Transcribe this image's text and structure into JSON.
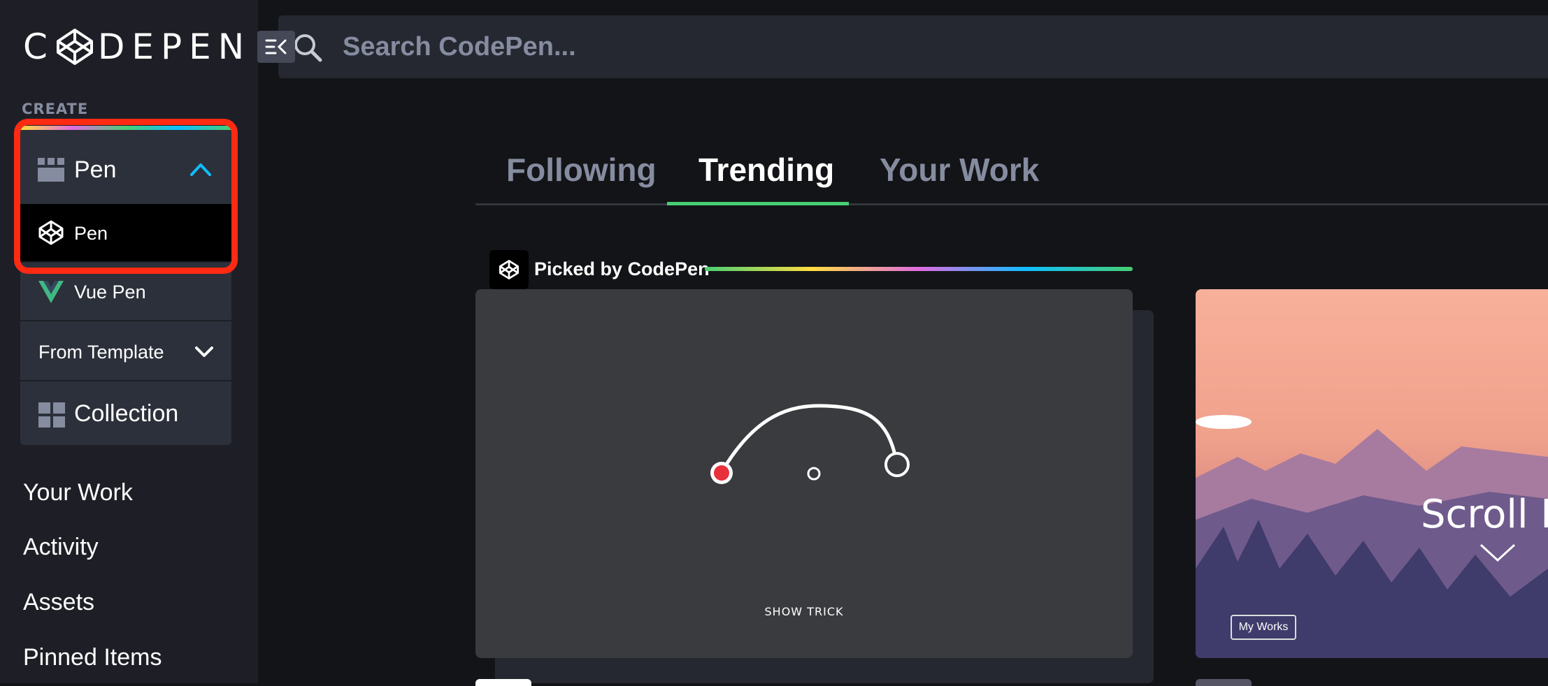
{
  "logo": {
    "text_left": "C",
    "text_right": "DEPEN"
  },
  "sidebar": {
    "create_label": "CREATE",
    "pen_header": "Pen",
    "pen_item": "Pen",
    "vue_item": "Vue Pen",
    "template_item": "From Template",
    "collection_item": "Collection",
    "nav": [
      "Your Work",
      "Activity",
      "Assets",
      "Pinned Items"
    ]
  },
  "search": {
    "placeholder": "Search CodePen..."
  },
  "tabs": [
    "Following",
    "Trending",
    "Your Work"
  ],
  "picked": {
    "label": "Picked by CodePen"
  },
  "card1": {
    "caption": "SHOW TRICK"
  },
  "card2": {
    "title": "Scroll D",
    "button": "My Works"
  },
  "colors": {
    "accent_green": "#47cf73",
    "highlight_red": "#ff2a12",
    "chevron_blue": "#0ebeff"
  }
}
